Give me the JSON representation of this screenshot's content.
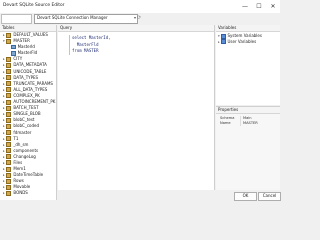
{
  "window": {
    "title": "Devart SQLite Source Editor",
    "minimize": "—",
    "maximize": "☐",
    "close": "✕"
  },
  "toolbar": {
    "connection": "Devart SQLite Connection Manager"
  },
  "tables_pane": {
    "header": "Tables",
    "items": [
      {
        "label": "DEFAULT_VALUES",
        "expanded": false,
        "child": false
      },
      {
        "label": "MASTER",
        "expanded": true,
        "child": false
      },
      {
        "label": "MasterId",
        "child": true
      },
      {
        "label": "MasterFld",
        "child": true
      },
      {
        "label": "CITY",
        "expanded": false,
        "child": false
      },
      {
        "label": "DATA_METADATA",
        "expanded": false,
        "child": false
      },
      {
        "label": "UNICODE_TABLE",
        "expanded": false,
        "child": false
      },
      {
        "label": "DATA_TYPES",
        "expanded": false,
        "child": false
      },
      {
        "label": "TRUNCATE_PARAMS",
        "expanded": false,
        "child": false
      },
      {
        "label": "ALL_DATA_TYPES",
        "expanded": false,
        "child": false
      },
      {
        "label": "COMPLEX_PK",
        "expanded": false,
        "child": false
      },
      {
        "label": "AUTOINCREMENT_PK",
        "expanded": false,
        "child": false
      },
      {
        "label": "BATCH_TEST",
        "expanded": false,
        "child": false
      },
      {
        "label": "SINGLE_BLOB",
        "expanded": false,
        "child": false
      },
      {
        "label": "blobC_test",
        "expanded": false,
        "child": false
      },
      {
        "label": "blobC_coded",
        "expanded": false,
        "child": false
      },
      {
        "label": "fdmaster",
        "expanded": false,
        "child": false
      },
      {
        "label": "T1",
        "expanded": false,
        "child": false
      },
      {
        "label": "_dh_sm",
        "expanded": false,
        "child": false
      },
      {
        "label": "components",
        "expanded": false,
        "child": false
      },
      {
        "label": "ChangeLog",
        "expanded": false,
        "child": false
      },
      {
        "label": "Files",
        "expanded": false,
        "child": false
      },
      {
        "label": "Mem1",
        "expanded": false,
        "child": false
      },
      {
        "label": "DateTimeTable",
        "expanded": false,
        "child": false
      },
      {
        "label": "Rows",
        "expanded": false,
        "child": false
      },
      {
        "label": "Movable",
        "expanded": false,
        "child": false
      },
      {
        "label": "BONDS",
        "expanded": false,
        "child": false
      }
    ]
  },
  "query_pane": {
    "header": "Query",
    "code": "select MasterId,\n  MasterFld\nfrom MASTER"
  },
  "variables_pane": {
    "header": "Variables",
    "items": [
      {
        "label": "System Variables",
        "expanded": true
      },
      {
        "label": "User Variables",
        "expanded": false
      }
    ]
  },
  "properties_pane": {
    "header": "Properties",
    "rows": [
      {
        "key": "Schema",
        "value": "Main"
      },
      {
        "key": "Name",
        "value": "MASTER"
      }
    ]
  },
  "footer": {
    "ok_label": "OK",
    "cancel_label": "Cancel"
  }
}
